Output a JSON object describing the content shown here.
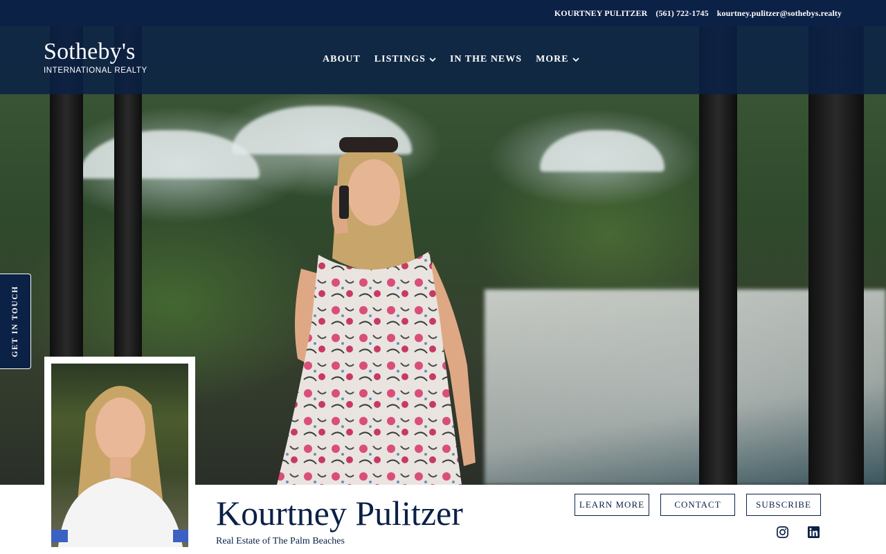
{
  "topbar": {
    "agent_name": "KOURTNEY PULITZER",
    "phone": "(561) 722-1745",
    "email": "kourtney.pulitzer@sothebys.realty"
  },
  "logo": {
    "main": "Sotheby's",
    "sub": "INTERNATIONAL REALTY"
  },
  "nav": {
    "items": [
      {
        "label": "ABOUT",
        "has_dropdown": false
      },
      {
        "label": "LISTINGS",
        "has_dropdown": true
      },
      {
        "label": "IN THE NEWS",
        "has_dropdown": false
      },
      {
        "label": "MORE",
        "has_dropdown": true
      }
    ]
  },
  "side_tab": {
    "label": "GET IN TOUCH"
  },
  "profile": {
    "name": "Kourtney Pulitzer",
    "tagline": "Real Estate of The Palm Beaches"
  },
  "actions": {
    "learn_more": "LEARN MORE",
    "contact": "CONTACT",
    "subscribe": "SUBSCRIBE"
  },
  "social": [
    {
      "icon": "instagram-icon"
    },
    {
      "icon": "linkedin-icon"
    }
  ],
  "colors": {
    "brand_navy": "#0b2146",
    "white": "#ffffff"
  }
}
